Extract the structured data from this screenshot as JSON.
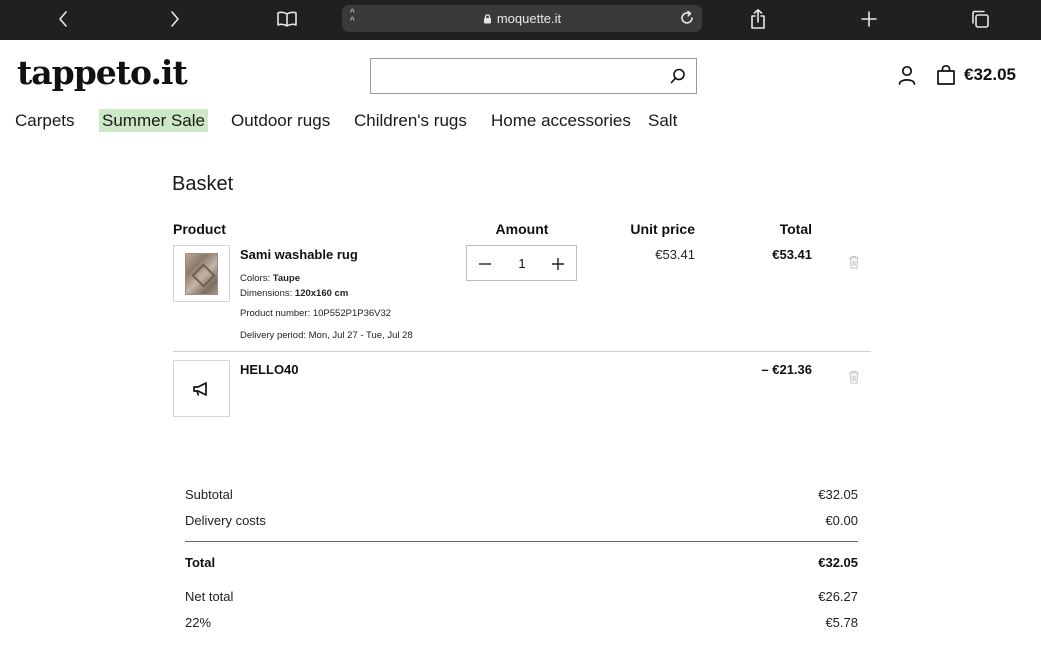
{
  "browser": {
    "url": "moquette.it",
    "text_size_label": "AA"
  },
  "header": {
    "logo": "tappeto.it",
    "search_placeholder": "",
    "cart_total": "€32.05"
  },
  "nav": {
    "items": [
      "Carpets",
      "Summer Sale",
      "Outdoor rugs",
      "Children's rugs",
      "Home accessories",
      "Salt"
    ]
  },
  "basket": {
    "title": "Basket",
    "columns": {
      "product": "Product",
      "amount": "Amount",
      "unit_price": "Unit price",
      "total": "Total"
    },
    "item": {
      "name": "Sami washable rug",
      "colors_label": "Colors:",
      "colors_value": "Taupe",
      "dimensions_label": "Dimensions:",
      "dimensions_value": "120x160 cm",
      "product_number": "Product number: 10P552P1P36V32",
      "delivery_period": "Delivery period: Mon, Jul 27 - Tue, Jul 28",
      "quantity": "1",
      "unit_price": "€53.41",
      "total": "€53.41"
    },
    "coupon": {
      "code": "HELLO40",
      "discount": "– €21.36"
    }
  },
  "summary": {
    "subtotal_label": "Subtotal",
    "subtotal_value": "€32.05",
    "delivery_label": "Delivery costs",
    "delivery_value": "€0.00",
    "total_label": "Total",
    "total_value": "€32.05",
    "net_label": "Net total",
    "net_value": "€26.27",
    "vat_label": "22%",
    "vat_value": "€5.78"
  },
  "icons": {
    "back": "chevron-left-icon",
    "forward": "chevron-right-icon",
    "bookmarks": "book-icon",
    "lock": "lock-icon",
    "reload": "reload-icon",
    "share": "share-icon",
    "new_tab": "plus-icon",
    "tabs": "tabs-icon",
    "search": "search-icon",
    "account": "user-icon",
    "cart": "shopping-bag-icon",
    "decrement": "minus-icon",
    "increment": "plus-icon",
    "delete": "trash-icon",
    "coupon": "megaphone-icon"
  },
  "colors": {
    "chrome_bg": "#202020",
    "sale_highlight": "#cde8c6",
    "text": "#111111"
  }
}
